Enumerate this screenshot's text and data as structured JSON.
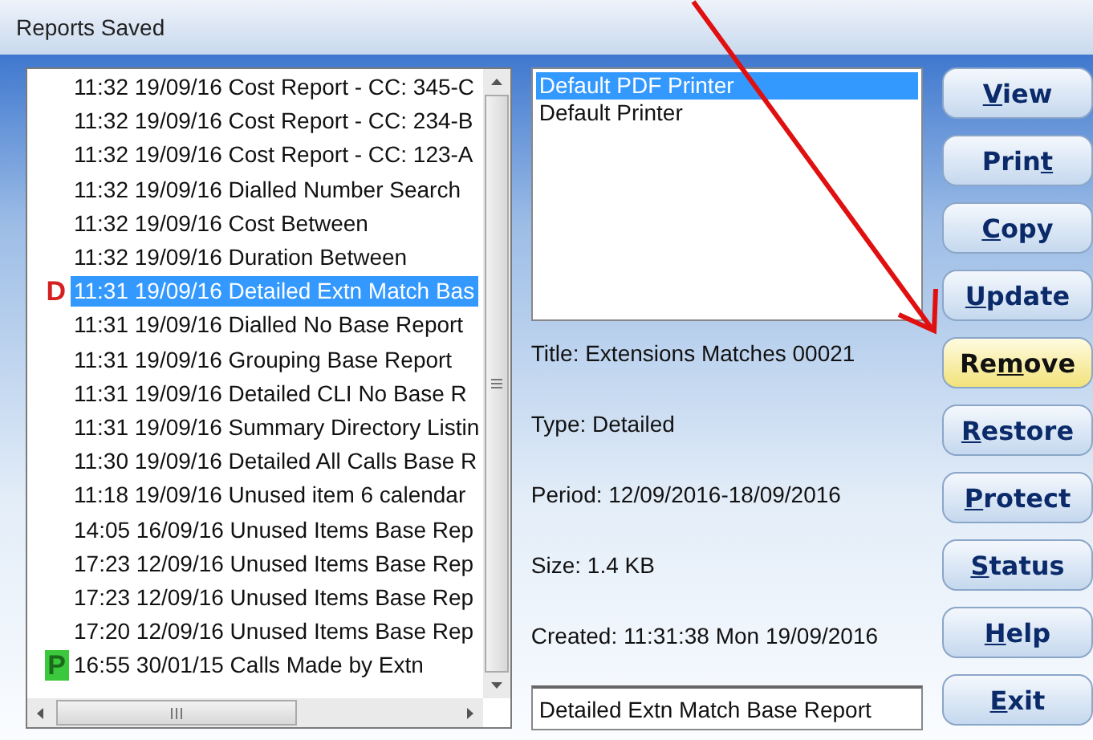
{
  "window": {
    "title": "Reports Saved"
  },
  "reports": [
    {
      "text": "11:32 19/09/16 Cost Report - CC: 345-C",
      "selected": false
    },
    {
      "text": "11:32 19/09/16 Cost Report - CC: 234-B",
      "selected": false
    },
    {
      "text": "11:32 19/09/16 Cost Report - CC: 123-A",
      "selected": false
    },
    {
      "text": "11:32 19/09/16 Dialled Number Search",
      "selected": false
    },
    {
      "text": "11:32 19/09/16 Cost Between",
      "selected": false
    },
    {
      "text": "11:32 19/09/16 Duration Between",
      "selected": false
    },
    {
      "text": "11:31 19/09/16 Detailed Extn Match Bas",
      "selected": true,
      "badge": {
        "kind": "outline",
        "text": "D"
      },
      "color": "#d42020"
    },
    {
      "text": "11:31 19/09/16 Dialled No Base Report",
      "selected": false
    },
    {
      "text": "11:31 19/09/16 Grouping Base Report",
      "selected": false
    },
    {
      "text": "11:31 19/09/16 Detailed CLI No Base R",
      "selected": false
    },
    {
      "text": "11:31 19/09/16 Summary Directory Listin",
      "selected": false
    },
    {
      "text": "11:30 19/09/16 Detailed All Calls Base R",
      "selected": false
    },
    {
      "text": "11:18 19/09/16 Unused item 6 calendar",
      "selected": false
    },
    {
      "text": "14:05 16/09/16 Unused Items Base Rep",
      "selected": false
    },
    {
      "text": "17:23 12/09/16 Unused Items Base Rep",
      "selected": false
    },
    {
      "text": "17:23 12/09/16 Unused Items Base Rep",
      "selected": false
    },
    {
      "text": "17:20 12/09/16 Unused Items Base Rep",
      "selected": false
    },
    {
      "text": "16:55 30/01/15 Calls Made by Extn",
      "selected": false,
      "badge": {
        "kind": "filled",
        "text": "P"
      },
      "color": "#3cc83c"
    }
  ],
  "printers": [
    {
      "name": "Default PDF Printer",
      "selected": true
    },
    {
      "name": "Default Printer",
      "selected": false
    }
  ],
  "details": [
    "Title: Extensions Matches 00021",
    "Type: Detailed",
    "Period: 12/09/2016-18/09/2016",
    "Size: 1.4 KB",
    "Created: 11:31:38 Mon 19/09/2016"
  ],
  "description_field": {
    "value": "Detailed Extn Match Base Report"
  },
  "buttons": [
    {
      "key": "V",
      "post": "iew",
      "highlighted": false
    },
    {
      "pre": "Prin",
      "key": "t",
      "highlighted": false
    },
    {
      "key": "C",
      "post": "opy",
      "highlighted": false
    },
    {
      "key": "U",
      "post": "pdate",
      "highlighted": false
    },
    {
      "pre": "Re",
      "key": "m",
      "post": "ove",
      "highlighted": true
    },
    {
      "key": "R",
      "post": "estore",
      "highlighted": false
    },
    {
      "key": "P",
      "post": "rotect",
      "highlighted": false
    },
    {
      "key": "S",
      "post": "tatus",
      "highlighted": false
    },
    {
      "key": "H",
      "post": "elp",
      "highlighted": false
    },
    {
      "key": "E",
      "post": "xit",
      "highlighted": false
    }
  ]
}
